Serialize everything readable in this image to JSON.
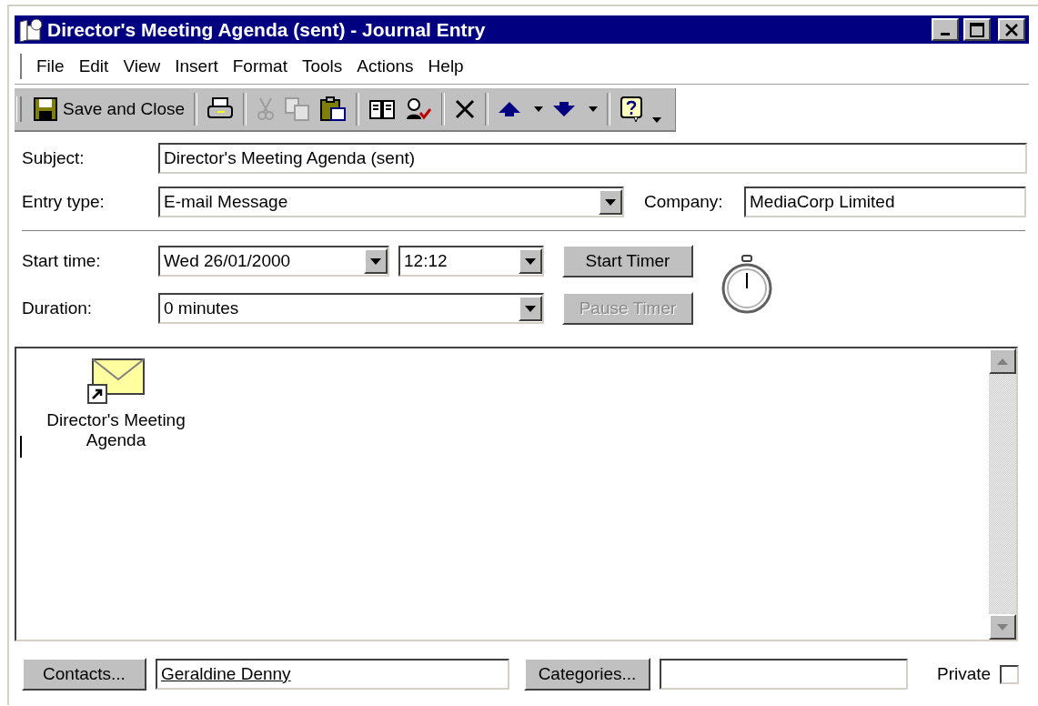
{
  "window": {
    "title": "Director's Meeting Agenda (sent) - Journal Entry"
  },
  "menu": [
    "File",
    "Edit",
    "View",
    "Insert",
    "Format",
    "Tools",
    "Actions",
    "Help"
  ],
  "toolbar": [
    {
      "kind": "save",
      "label": "Save and Close",
      "disabled": false
    },
    {
      "kind": "print",
      "disabled": false
    },
    {
      "kind": "cut",
      "disabled": true
    },
    {
      "kind": "copy",
      "disabled": true
    },
    {
      "kind": "paste",
      "disabled": false
    },
    {
      "kind": "book",
      "disabled": false
    },
    {
      "kind": "checknames",
      "disabled": false
    },
    {
      "kind": "delete",
      "disabled": false
    },
    {
      "kind": "up",
      "disabled": false
    },
    {
      "kind": "down",
      "disabled": false
    },
    {
      "kind": "help",
      "disabled": false
    }
  ],
  "subject": {
    "label": "Subject:",
    "value": "Director's Meeting Agenda (sent)"
  },
  "entry_type": {
    "label": "Entry type:",
    "value": "E-mail Message"
  },
  "company": {
    "label": "Company:",
    "value": "MediaCorp Limited"
  },
  "start_time": {
    "label": "Start time:",
    "date": "Wed 26/01/2000",
    "time": "12:12"
  },
  "duration": {
    "label": "Duration:",
    "value": "0 minutes"
  },
  "timer_buttons": [
    {
      "label": "Start Timer",
      "disabled": false
    },
    {
      "label": "Pause Timer",
      "disabled": true
    }
  ],
  "body": {
    "attachment": {
      "name": "Director's Meeting Agenda"
    }
  },
  "contacts": {
    "button": "Contacts...",
    "value": "Geraldine Denny"
  },
  "categories": {
    "button": "Categories..."
  },
  "private": {
    "label": "Private",
    "checked": false
  }
}
